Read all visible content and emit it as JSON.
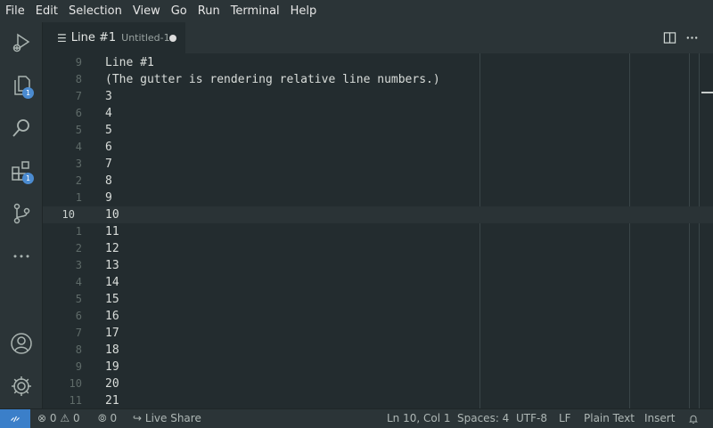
{
  "menu": [
    "File",
    "Edit",
    "Selection",
    "View",
    "Go",
    "Run",
    "Terminal",
    "Help"
  ],
  "activity_bar": {
    "explorer_badge": "1",
    "extensions_badge": "1"
  },
  "tab": {
    "title": "Line #1",
    "description": "Untitled-1"
  },
  "editor": {
    "lines": [
      {
        "num": "9",
        "text": "Line #1"
      },
      {
        "num": "8",
        "text": "(The gutter is rendering relative line numbers.)"
      },
      {
        "num": "7",
        "text": "3"
      },
      {
        "num": "6",
        "text": "4"
      },
      {
        "num": "5",
        "text": "5"
      },
      {
        "num": "4",
        "text": "6"
      },
      {
        "num": "3",
        "text": "7"
      },
      {
        "num": "2",
        "text": "8"
      },
      {
        "num": "1",
        "text": "9"
      },
      {
        "num": "10",
        "text": "10"
      },
      {
        "num": "1",
        "text": "11"
      },
      {
        "num": "2",
        "text": "12"
      },
      {
        "num": "3",
        "text": "13"
      },
      {
        "num": "4",
        "text": "14"
      },
      {
        "num": "5",
        "text": "15"
      },
      {
        "num": "6",
        "text": "16"
      },
      {
        "num": "7",
        "text": "17"
      },
      {
        "num": "8",
        "text": "18"
      },
      {
        "num": "9",
        "text": "19"
      },
      {
        "num": "10",
        "text": "20"
      },
      {
        "num": "11",
        "text": "21"
      }
    ]
  },
  "status": {
    "errors": "0",
    "warnings": "0",
    "ports": "0",
    "live_share": "Live Share",
    "position": "Ln 10, Col 1",
    "spaces": "Spaces: 4",
    "encoding": "UTF-8",
    "eol": "LF",
    "language": "Plain Text",
    "mode": "Insert"
  }
}
